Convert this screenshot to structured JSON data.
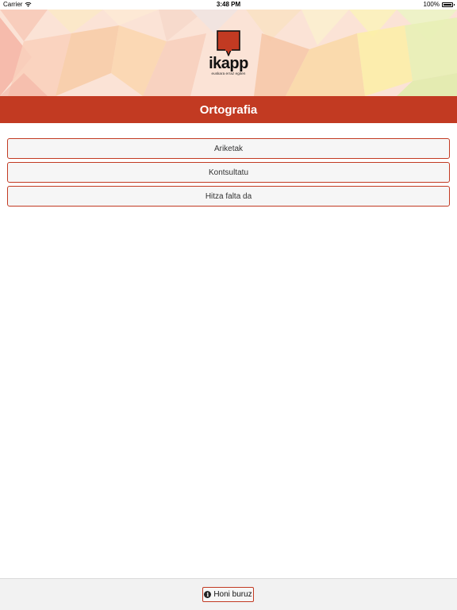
{
  "status_bar": {
    "carrier": "Carrier",
    "time": "3:48 PM",
    "battery": "100%"
  },
  "logo": {
    "wordmark": "ikapp",
    "tagline": "euskara erraz egiten",
    "brand_color": "#c23a22"
  },
  "header": {
    "title": "Ortografia"
  },
  "menu": {
    "items": [
      {
        "label": "Ariketak"
      },
      {
        "label": "Kontsultatu"
      },
      {
        "label": "Hitza falta da"
      }
    ]
  },
  "footer": {
    "about_label": "Honi buruz",
    "about_icon": "info-icon"
  }
}
